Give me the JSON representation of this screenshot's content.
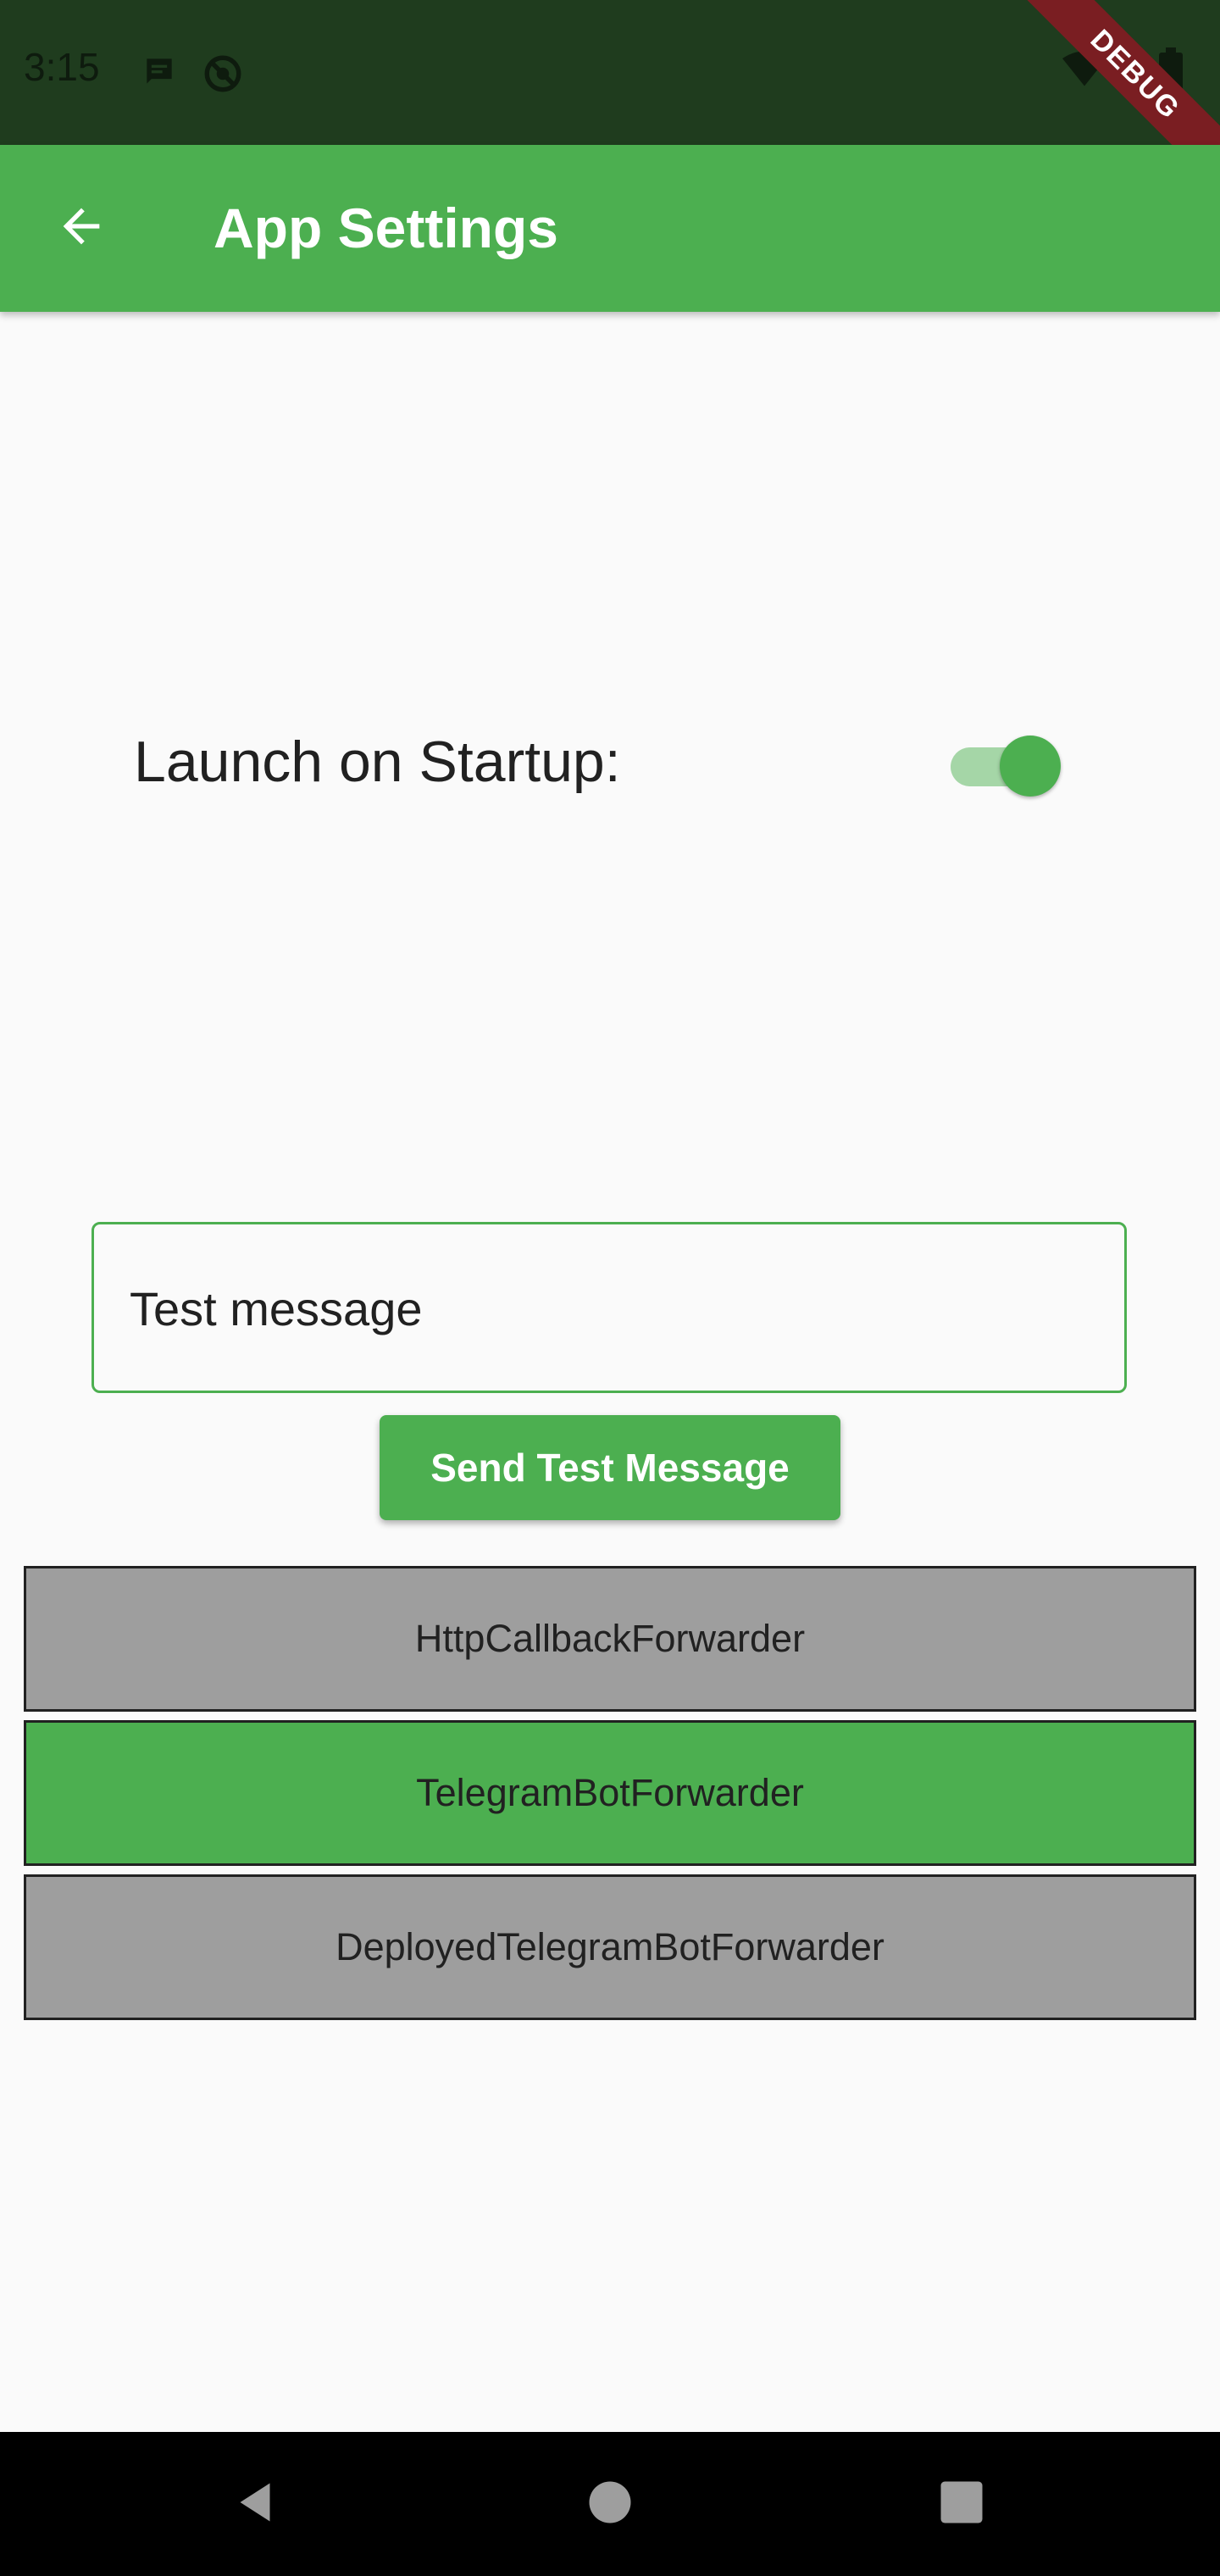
{
  "status_bar": {
    "time": "3:15",
    "icons": [
      "message-icon",
      "sync-off-icon",
      "wifi-icon",
      "signal-icon",
      "battery-icon"
    ]
  },
  "debug_banner": {
    "label": "DEBUG"
  },
  "app_bar": {
    "title": "App Settings",
    "back_icon": "arrow-back-icon"
  },
  "settings": {
    "launch_on_startup_label": "Launch on Startup:",
    "launch_on_startup_enabled": true
  },
  "test_message": {
    "value": "Test message",
    "send_button_label": "Send Test Message"
  },
  "forwarders": [
    {
      "label": "HttpCallbackForwarder",
      "selected": false
    },
    {
      "label": "TelegramBotForwarder",
      "selected": true
    },
    {
      "label": "DeployedTelegramBotForwarder",
      "selected": false
    }
  ],
  "colors": {
    "primary": "#4caf50",
    "primary_light": "#a5d6a7",
    "inactive": "#9e9e9e",
    "status_bar": "#1f3c1e",
    "debug_ribbon": "#7a1e22"
  },
  "nav_bar": {
    "buttons": [
      "back-triangle-icon",
      "home-circle-icon",
      "recents-square-icon"
    ]
  }
}
